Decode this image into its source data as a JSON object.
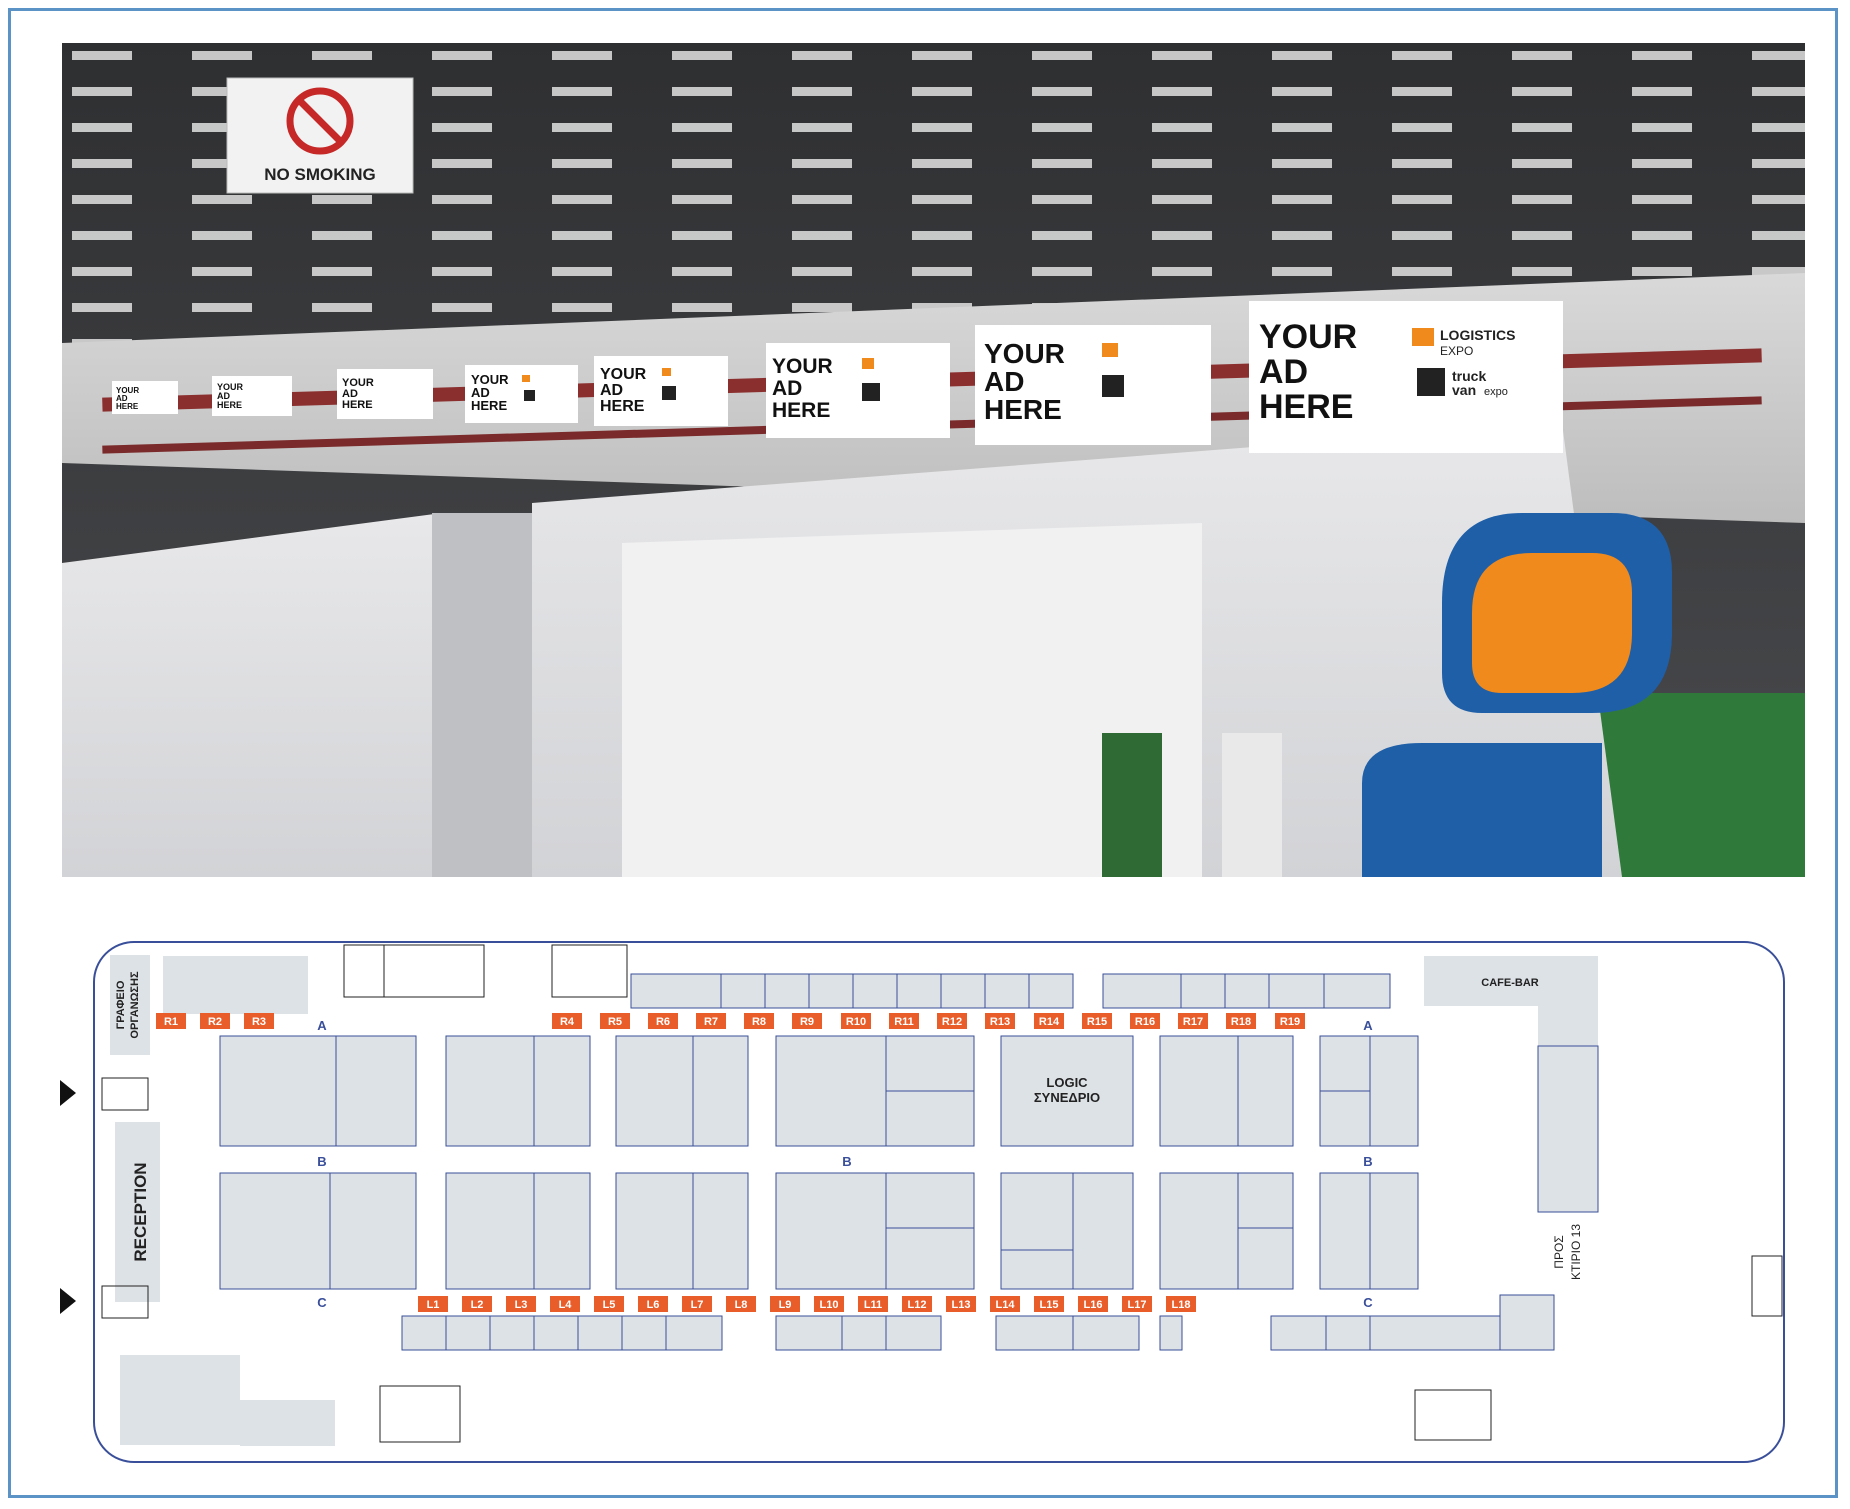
{
  "photo": {
    "sign_text": "NO SMOKING",
    "banner_text": [
      "YOUR",
      "AD",
      "HERE"
    ],
    "logo_text": "LOGISTICS",
    "logo_sub": "EXPO",
    "logo2_text": "truck",
    "logo2_sub": "van",
    "logo2_sub2": "expo"
  },
  "floorplan": {
    "cafe_bar": "CAFE-BAR",
    "office_line1": "ΓΡΑΦΕΙΟ",
    "office_line2": "ΟΡΓΑΝΩΣΗΣ",
    "reception": "RECEPTION",
    "logic_line1": "LOGIC",
    "logic_line2": "ΣΥΝΕΔΡΙΟ",
    "exit_line1": "ΠΡΟΣ",
    "exit_line2": "ΚΤΙΡΙΟ 13",
    "row_labels": {
      "a": "A",
      "b": "B",
      "c": "C"
    },
    "r_tags": [
      "R1",
      "R2",
      "R3",
      "R4",
      "R5",
      "R6",
      "R7",
      "R8",
      "R9",
      "R10",
      "R11",
      "R12",
      "R13",
      "R14",
      "R15",
      "R16",
      "R17",
      "R18",
      "R19"
    ],
    "l_tags": [
      "L1",
      "L2",
      "L3",
      "L4",
      "L5",
      "L6",
      "L7",
      "L8",
      "L9",
      "L10",
      "L11",
      "L12",
      "L13",
      "L14",
      "L15",
      "L16",
      "L17",
      "L18"
    ],
    "colors": {
      "tag": "#e85d2a",
      "booth": "#dde2e7",
      "line": "#3a4f9a",
      "frame": "#5b93c7"
    }
  }
}
